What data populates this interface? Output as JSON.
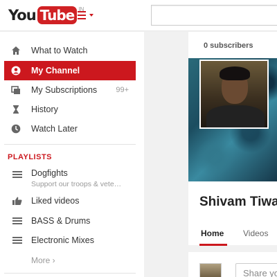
{
  "header": {
    "logo_you": "You",
    "logo_tube": "Tube",
    "logo_country": "IN",
    "search_placeholder": ""
  },
  "sidebar": {
    "nav": [
      {
        "label": "What to Watch",
        "icon": "home-icon"
      },
      {
        "label": "My Channel",
        "icon": "user-circle-icon",
        "active": true
      },
      {
        "label": "My Subscriptions",
        "icon": "subscriptions-icon",
        "count": "99+"
      },
      {
        "label": "History",
        "icon": "hourglass-icon"
      },
      {
        "label": "Watch Later",
        "icon": "clock-icon"
      }
    ],
    "playlists_title": "PLAYLISTS",
    "playlists": [
      {
        "label": "Dogfights",
        "sub": "Support our troops & vete…",
        "icon": "playlist-icon"
      },
      {
        "label": "Liked videos",
        "icon": "thumbs-up-icon"
      },
      {
        "label": "BASS & Drums",
        "icon": "playlist-icon"
      },
      {
        "label": "Electronic Mixes",
        "icon": "playlist-icon"
      }
    ],
    "more_label": "More ›"
  },
  "channel": {
    "subscribers": "0 subscribers",
    "name": "Shivam Tiwa",
    "tabs": [
      "Home",
      "Videos"
    ],
    "active_tab": "Home",
    "share_placeholder": "Share yo"
  },
  "colors": {
    "accent": "#cc181e",
    "background": "#f1f1f1"
  }
}
